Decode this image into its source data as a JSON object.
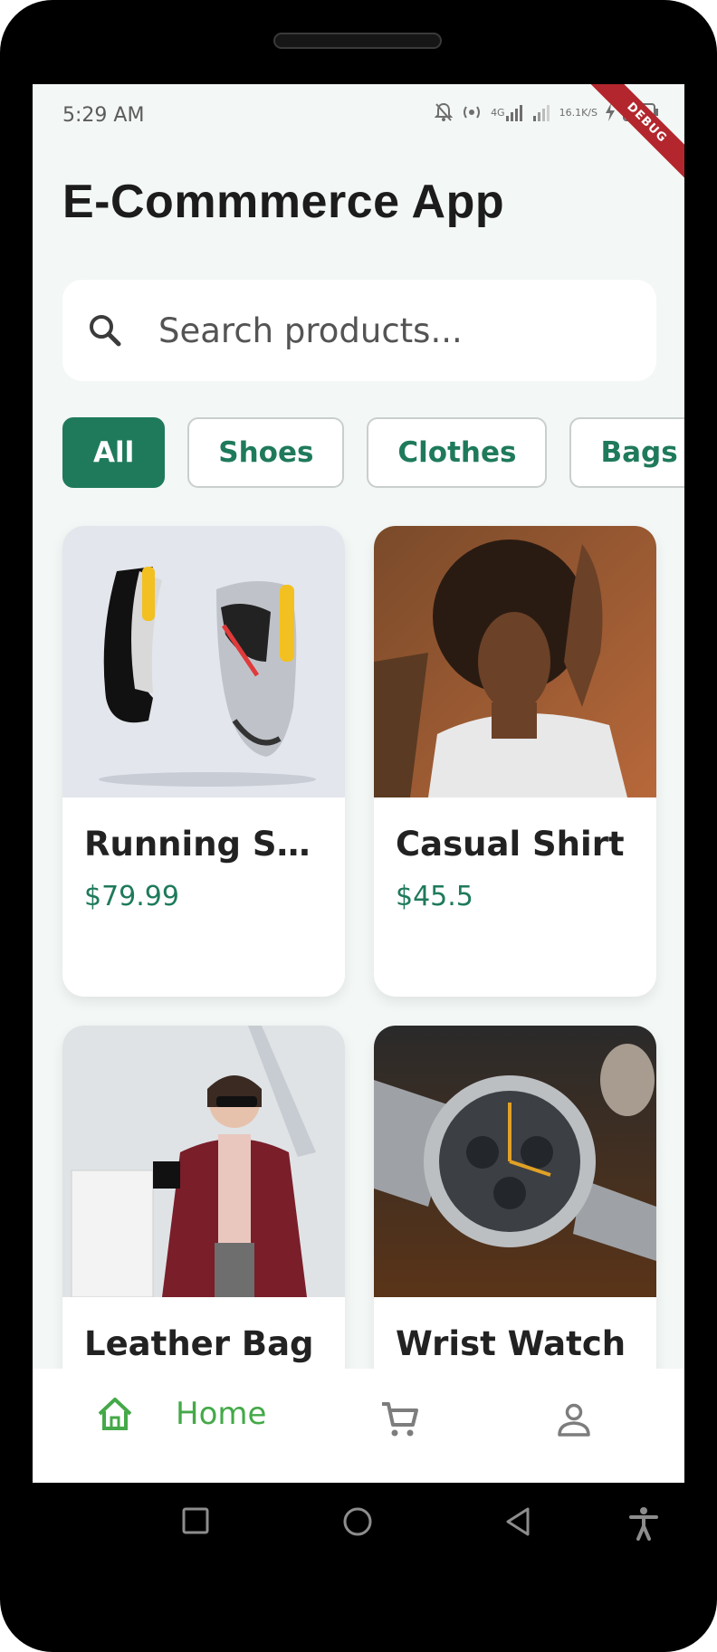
{
  "status_bar": {
    "time": "5:29 AM",
    "network_type": "4G",
    "net_speed_value": "16.1",
    "net_speed_unit": "K/S",
    "debug_label": "DEBUG"
  },
  "app": {
    "title": "E-Commmerce App"
  },
  "search": {
    "placeholder": "Search products..."
  },
  "categories": [
    {
      "label": "All",
      "active": true
    },
    {
      "label": "Shoes",
      "active": false
    },
    {
      "label": "Clothes",
      "active": false
    },
    {
      "label": "Bags",
      "active": false
    }
  ],
  "products": [
    {
      "name": "Running Sh...",
      "price": "$79.99",
      "image": "sneakers-photo"
    },
    {
      "name": "Casual Shirt",
      "price": "$45.5",
      "image": "woman-white-tee-photo"
    },
    {
      "name": "Leather Bag",
      "price": "",
      "image": "woman-shopping-bags-photo"
    },
    {
      "name": "Wrist Watch",
      "price": "",
      "image": "chronograph-watch-photo"
    }
  ],
  "bottom_nav": {
    "home_label": "Home",
    "items": [
      "home-icon",
      "cart-icon",
      "profile-icon"
    ]
  },
  "colors": {
    "accent": "#1f7a5c",
    "nav_active": "#44a948",
    "screen_bg": "#f3f7f5",
    "debug": "#b3262d"
  }
}
